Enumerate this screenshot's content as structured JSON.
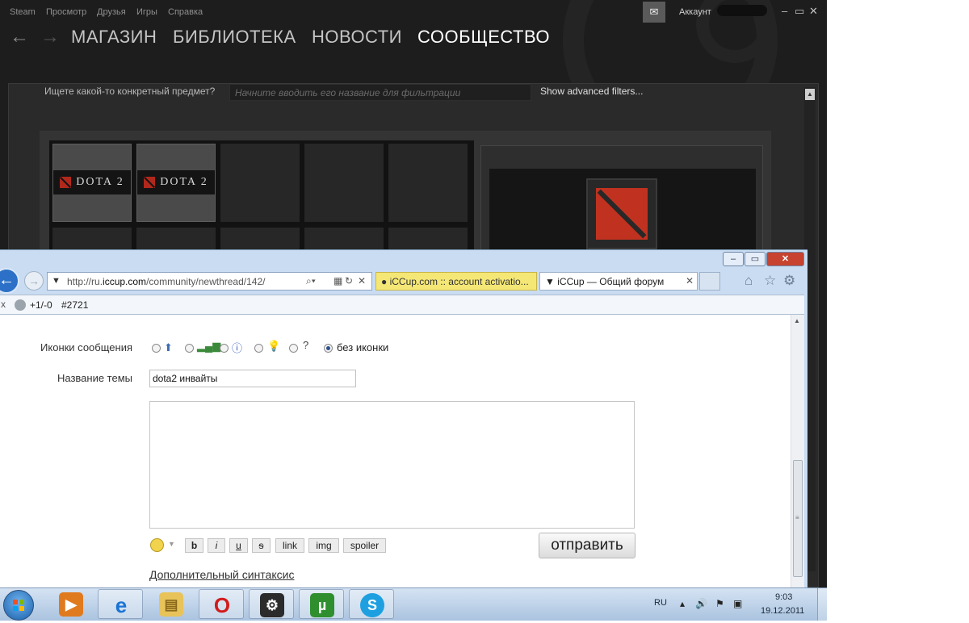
{
  "steam": {
    "menu": [
      "Steam",
      "Просмотр",
      "Друзья",
      "Игры",
      "Справка"
    ],
    "nav_tabs": [
      "МАГАЗИН",
      "БИБЛИОТЕКА",
      "НОВОСТИ",
      "СООБЩЕСТВО"
    ],
    "active_tab": "СООБЩЕСТВО",
    "account_label": "Аккаунт",
    "window_controls": [
      "–",
      "▭",
      "✕"
    ],
    "filter": {
      "label": "Ищете какой-то конкретный предмет?",
      "placeholder": "Начните вводить его название для фильтрации",
      "advanced_link": "Show advanced filters..."
    },
    "inventory_items": [
      "DOTA 2",
      "DOTA 2"
    ]
  },
  "ie": {
    "window_controls": [
      "–",
      "▭",
      "✕"
    ],
    "address": {
      "url_prefix": "http://ru.",
      "url_domain": "iccup.com",
      "url_path": "/community/newthread/142/"
    },
    "tabs": [
      {
        "title": "iCCup.com :: account activatio...",
        "active": false
      },
      {
        "title": "iCCup — Общий форум",
        "active": true,
        "close": "✕"
      }
    ],
    "favbar": {
      "score": "+1/-0",
      "number": "#2721"
    },
    "form": {
      "icons_label": "Иконки сообщения",
      "no_icon_label": "без иконки",
      "subject_label": "Название темы",
      "subject_value": "dota2 инвайты",
      "message_value": "",
      "format_buttons": [
        "b",
        "i",
        "u",
        "s",
        "link",
        "img",
        "spoiler"
      ],
      "submit_label": "отправить",
      "extra_syntax_link": "Дополнительный синтаксис"
    }
  },
  "taskbar": {
    "apps": [
      "windows-media-player",
      "internet-explorer",
      "file-explorer",
      "opera",
      "steam",
      "utorrent",
      "skype"
    ],
    "lang": "RU",
    "time": "9:03",
    "date": "19.12.2011"
  }
}
